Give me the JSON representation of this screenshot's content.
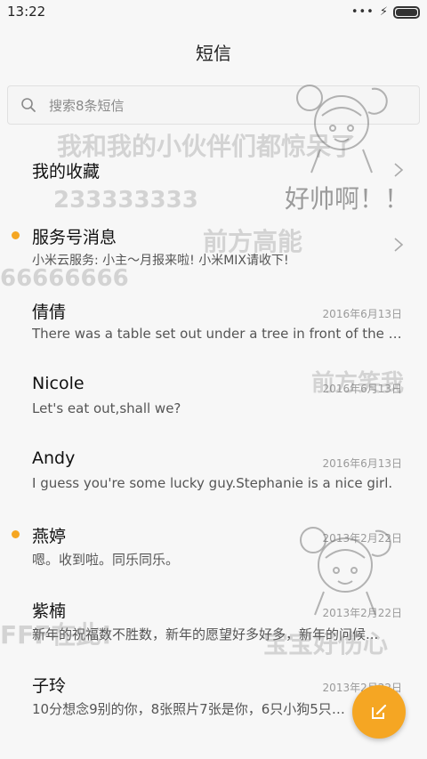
{
  "status_bar": {
    "time": "13:22",
    "battery_level": 1.0
  },
  "header": {
    "title": "短信"
  },
  "search": {
    "placeholder": "搜索8条短信"
  },
  "conversations": [
    {
      "name": "我的收藏",
      "preview": "",
      "date": "",
      "unread": false,
      "has_chevron": true
    },
    {
      "name": "服务号消息",
      "preview": "小米云服务: 小主～月报来啦! 小米MIX请收下!",
      "date": "",
      "unread": true,
      "has_chevron": true
    },
    {
      "name": "倩倩",
      "preview": "There was a table set out under a tree in front of the ho...",
      "date": "2016年6月13日",
      "unread": false,
      "has_chevron": false
    },
    {
      "name": "Nicole",
      "preview": "Let's eat out,shall we?",
      "date": "2016年6月13日",
      "unread": false,
      "has_chevron": false
    },
    {
      "name": "Andy",
      "preview": "I guess you're some lucky guy.Stephanie is a nice girl.",
      "date": "2016年6月13日",
      "unread": false,
      "has_chevron": false
    },
    {
      "name": "燕婷",
      "preview": "嗯。收到啦。同乐同乐。",
      "date": "2013年2月22日",
      "unread": true,
      "has_chevron": false
    },
    {
      "name": "紫楠",
      "preview": "新年的祝福数不胜数，新年的愿望好多好多，新年的问候...",
      "date": "2013年2月22日",
      "unread": false,
      "has_chevron": false
    },
    {
      "name": "子玲",
      "preview": "10分想念9别的你，8张照片7张是你，6只小狗5只像你",
      "date": "2013年2月22日",
      "unread": false,
      "has_chevron": false
    }
  ],
  "watermarks": [
    "我和我的小伙伴们都惊呆了",
    "233333333",
    "好帅啊！！",
    "前方高能",
    "66666666",
    "前方笑我",
    "宝宝好伤心",
    "FFF在此!"
  ],
  "icons": {
    "search": "magnifier",
    "chevron": "chevron-right",
    "compose": "pencil-square"
  },
  "colors": {
    "accent": "#f5a623",
    "background": "#f7f7f7"
  }
}
